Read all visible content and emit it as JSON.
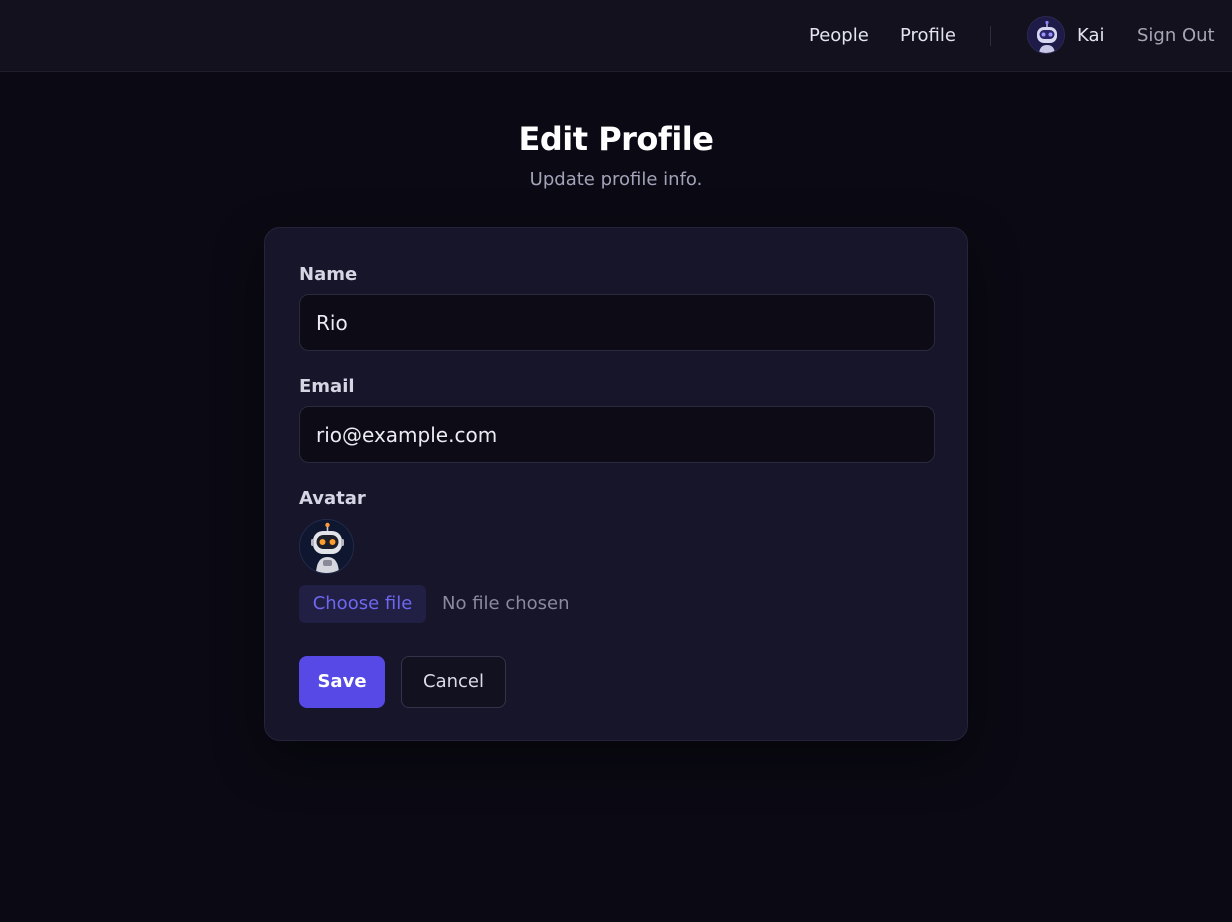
{
  "nav": {
    "people": "People",
    "profile": "Profile",
    "user_avatar_icon": "robot-avatar-icon",
    "username": "Kai",
    "sign_out": "Sign Out"
  },
  "header": {
    "title": "Edit Profile",
    "subtitle": "Update profile info."
  },
  "form": {
    "name_label": "Name",
    "name_value": "Rio",
    "email_label": "Email",
    "email_value": "rio@example.com",
    "avatar_label": "Avatar",
    "avatar_icon": "robot-avatar-icon",
    "choose_file": "Choose file",
    "file_status": "No file chosen",
    "save": "Save",
    "cancel": "Cancel"
  },
  "colors": {
    "background": "#0b0a14",
    "card": "#16152a",
    "accent": "#5649e6",
    "accent_text": "#6e67f0"
  }
}
